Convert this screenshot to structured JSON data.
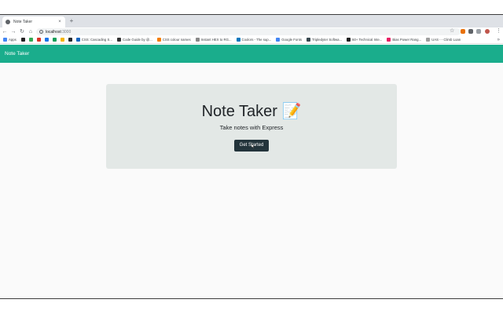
{
  "browser": {
    "tab_title": "Note Taker",
    "tab_close": "×",
    "new_tab": "+",
    "nav": {
      "back": "←",
      "forward": "→",
      "reload": "↻",
      "home": "⌂"
    },
    "address_host": "localhost",
    "address_port": ":3000",
    "star": "☆",
    "menu": "⋮",
    "bookmarks_more": "»",
    "bookmarks": [
      {
        "label": "Apps",
        "color": "#4285f4"
      },
      {
        "label": "",
        "color": "#222222"
      },
      {
        "label": "",
        "color": "#34a853"
      },
      {
        "label": "",
        "color": "#d93025"
      },
      {
        "label": "",
        "color": "#1a73e8"
      },
      {
        "label": "",
        "color": "#0f9d58"
      },
      {
        "label": "",
        "color": "#f4b400"
      },
      {
        "label": "",
        "color": "#24292e"
      },
      {
        "label": "CSS: Cascading S...",
        "color": "#1565c0"
      },
      {
        "label": "Code Guide by @...",
        "color": "#333333"
      },
      {
        "label": "CSS colour names",
        "color": "#f57c00"
      },
      {
        "label": "Instant HEX to RG...",
        "color": "#888888"
      },
      {
        "label": "Coolors - The sup...",
        "color": "#0277bd"
      },
      {
        "label": "Google Fonts",
        "color": "#4285f4"
      },
      {
        "label": "Tripledyter Softwa...",
        "color": "#37474f"
      },
      {
        "label": "60+ Technical Inte...",
        "color": "#212121"
      },
      {
        "label": "Bias Power Rang...",
        "color": "#e91e63"
      },
      {
        "label": "UAS - - Climb Loan",
        "color": "#9e9e9e"
      }
    ]
  },
  "app": {
    "brand": "Note Taker",
    "heading": "Note Taker 📝",
    "lead": "Take notes with Express",
    "cta_label": "Get Started"
  },
  "colors": {
    "navbar": "#1aad8c",
    "jumbotron": "#e3e8e6",
    "button": "#23343b"
  }
}
